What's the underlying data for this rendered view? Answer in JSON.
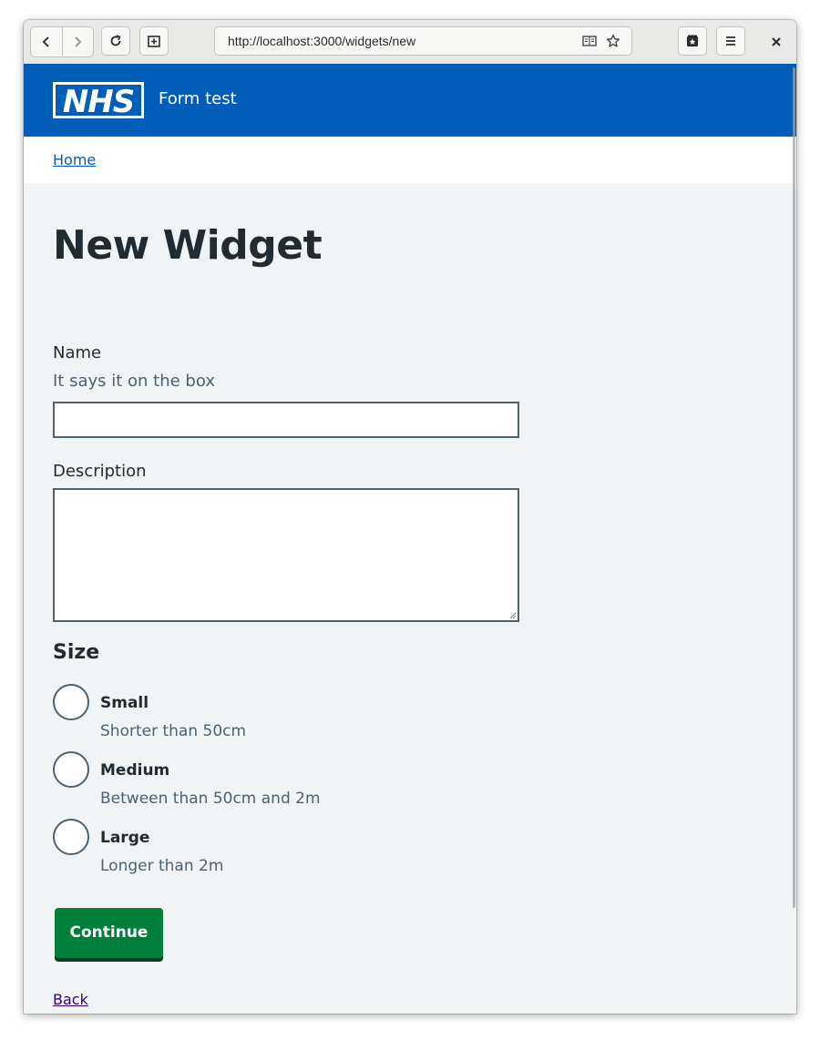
{
  "browser": {
    "url": "http://localhost:3000/widgets/new",
    "icons": [
      "chevron-left-icon",
      "chevron-right-icon",
      "reload-icon",
      "new-tab-icon",
      "reader-view-icon",
      "bookmark-star-icon",
      "bookmarks-menu-icon",
      "hamburger-menu-icon",
      "close-icon"
    ]
  },
  "header": {
    "logo_text": "NHS",
    "service_name": "Form test",
    "brand_color": "#005eb8"
  },
  "breadcrumb": {
    "home_label": "Home"
  },
  "page": {
    "title": "New Widget"
  },
  "form": {
    "name": {
      "label": "Name",
      "hint": "It says it on the box",
      "value": ""
    },
    "description": {
      "label": "Description",
      "value": ""
    },
    "size": {
      "legend": "Size",
      "options": [
        {
          "label": "Small",
          "hint": "Shorter than 50cm",
          "selected": false
        },
        {
          "label": "Medium",
          "hint": "Between than 50cm and 2m",
          "selected": false
        },
        {
          "label": "Large",
          "hint": "Longer than 2m",
          "selected": false
        }
      ]
    },
    "submit_label": "Continue",
    "submit_color": "#007f3b"
  },
  "back_link": "Back"
}
